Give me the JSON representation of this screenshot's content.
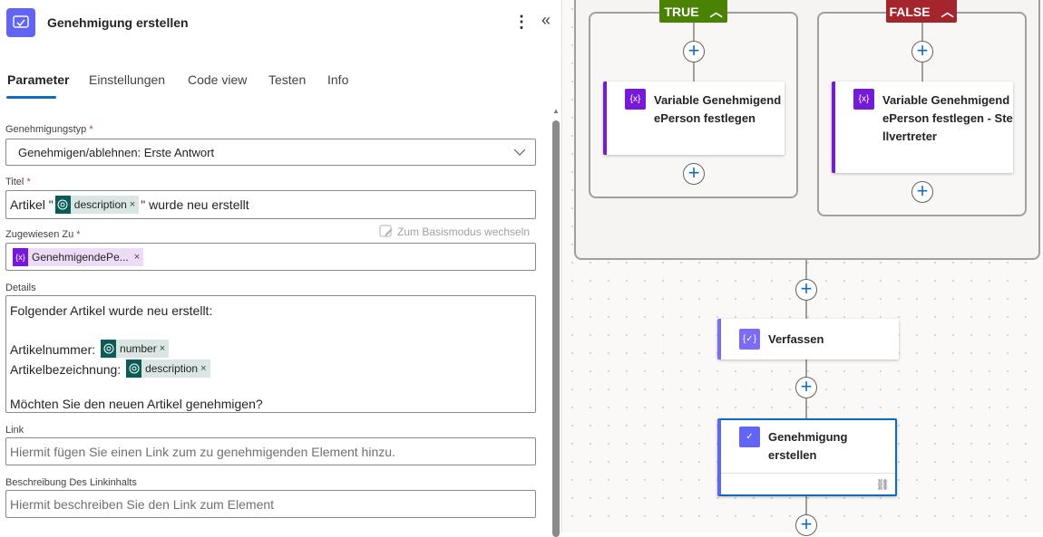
{
  "panel": {
    "title": "Genehmigung erstellen",
    "tabs": [
      {
        "label": "Parameter",
        "active": true
      },
      {
        "label": "Einstellungen"
      },
      {
        "label": "Code view"
      },
      {
        "label": "Testen"
      },
      {
        "label": "Info"
      }
    ],
    "approval_type": {
      "label": "Genehmigungstyp",
      "required": "*",
      "value": "Genehmigen/ablehnen: Erste Antwort"
    },
    "title_field": {
      "label": "Titel",
      "required": "*",
      "prefix": "Artikel \"",
      "token": "description",
      "suffix": "\" wurde neu erstellt"
    },
    "basic_mode_link": "Zum Basismodus wechseln",
    "assigned": {
      "label": "Zugewiesen Zu",
      "required": "*",
      "token": "GenehmigendePe..."
    },
    "details": {
      "label": "Details",
      "line1": "Folgender Artikel wurde neu erstellt:",
      "line2_label": "Artikelnummer:",
      "line2_token": "number",
      "line3_label": "Artikelbezeichnung:",
      "line3_token": "description",
      "line4": "Möchten Sie den neuen Artikel genehmigen?"
    },
    "link": {
      "label": "Link",
      "placeholder": "Hiermit fügen Sie einen Link zum zu genehmigenden Element hinzu."
    },
    "link_desc": {
      "label": "Beschreibung Des Linkinhalts",
      "placeholder": "Hiermit beschreiben Sie den Link zum Element"
    },
    "token_close": "×"
  },
  "canvas": {
    "true_label": "TRUE",
    "false_label": "FALSE",
    "true_card": "Variable GenehmigendePerson festlegen",
    "false_card": "Variable GenehmigendePerson festlegen - Stellvertreter",
    "compose_card": "Verfassen",
    "approval_card": "Genehmigung erstellen",
    "colors": {
      "true": "#498205",
      "false": "#a4262c",
      "variable": "#7719d8",
      "approval": "#6264f5",
      "selected": "#0f6cbd"
    }
  }
}
